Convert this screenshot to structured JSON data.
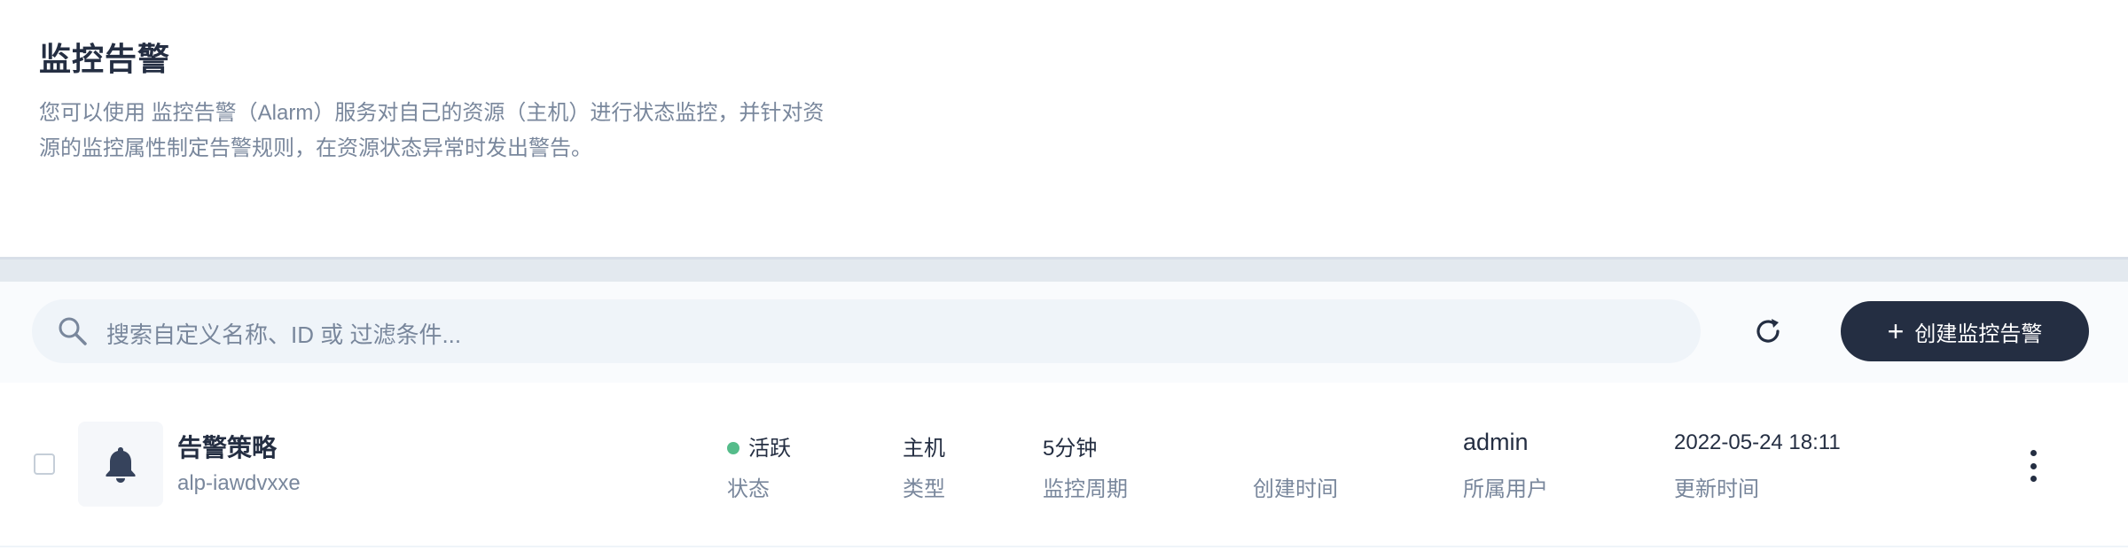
{
  "header": {
    "title": "监控告警",
    "description": "您可以使用 监控告警（Alarm）服务对自己的资源（主机）进行状态监控，并针对资源的监控属性制定告警规则，在资源状态异常时发出警告。"
  },
  "toolbar": {
    "search_placeholder": "搜索自定义名称、ID 或 过滤条件...",
    "create_button_label": "创建监控告警",
    "create_button_icon": "plus-icon",
    "refresh_icon": "refresh-icon"
  },
  "rows": [
    {
      "icon": "bell-icon",
      "name": "告警策略",
      "id": "alp-iawdvxxe",
      "status": {
        "value": "活跃",
        "label": "状态",
        "color": "#55bc8a"
      },
      "type": {
        "value": "主机",
        "label": "类型"
      },
      "period": {
        "value": "5分钟",
        "label": "监控周期"
      },
      "created": {
        "value": "",
        "label": "创建时间"
      },
      "user": {
        "value": "admin",
        "label": "所属用户"
      },
      "updated": {
        "value": "2022-05-24 18:11",
        "label": "更新时间"
      }
    }
  ],
  "colors": {
    "primary_dark": "#242e42",
    "muted_text": "#79879c",
    "status_active": "#55bc8a",
    "search_bg": "#eff4f9"
  }
}
